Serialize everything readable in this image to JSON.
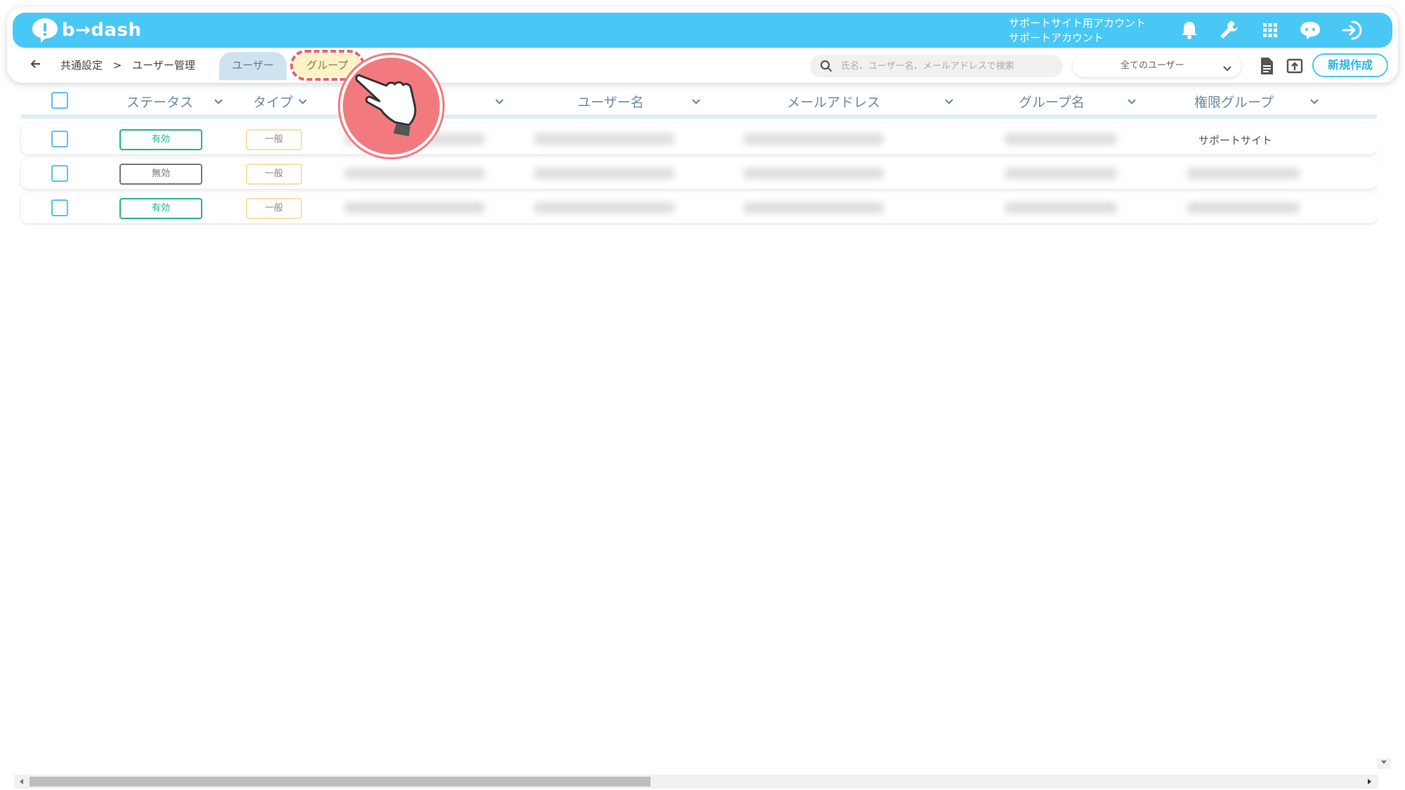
{
  "header": {
    "logo_text": "b→dash",
    "account_line1": "サポートサイト用アカウント",
    "account_line2": "サポートアカウント",
    "icons": [
      "bell-icon",
      "wrench-icon",
      "apps-grid-icon",
      "support-chat-icon",
      "logout-icon"
    ]
  },
  "subbar": {
    "breadcrumb_root": "共通設定",
    "breadcrumb_sep": ">",
    "breadcrumb_current": "ユーザー管理",
    "tab_user": "ユーザー",
    "tab_group": "グループ",
    "search_placeholder": "氏名、ユーザー名、メールアドレスで検索",
    "filter_value": "全てのユーザー",
    "new_button": "新規作成"
  },
  "table": {
    "columns": [
      "ステータス",
      "タイプ",
      "ユーザー名",
      "メールアドレス",
      "グループ名",
      "権限グループ"
    ],
    "rows": [
      {
        "status": "有効",
        "status_kind": "active",
        "type": "一般",
        "permission_group": "サポートサイト"
      },
      {
        "status": "無効",
        "status_kind": "inactive",
        "type": "一般",
        "permission_group": ""
      },
      {
        "status": "有効",
        "status_kind": "active",
        "type": "一般",
        "permission_group": ""
      }
    ]
  },
  "colors": {
    "brand": "#49c8f5",
    "active": "#26b58a",
    "inactive": "#777777",
    "highlight": "#e86371"
  }
}
